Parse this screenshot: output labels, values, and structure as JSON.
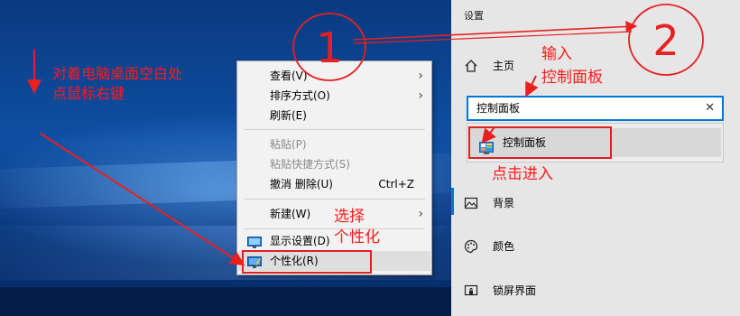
{
  "context_menu": {
    "items": [
      {
        "label": "查看(V)",
        "disabled": false,
        "arrow": true
      },
      {
        "label": "排序方式(O)",
        "disabled": false,
        "arrow": true
      },
      {
        "label": "刷新(E)",
        "disabled": false,
        "arrow": false
      },
      {
        "label": "粘贴(P)",
        "disabled": true,
        "arrow": false
      },
      {
        "label": "粘贴快捷方式(S)",
        "disabled": true,
        "arrow": false
      },
      {
        "label": "撤消 删除(U)",
        "shortcut": "Ctrl+Z",
        "disabled": false,
        "arrow": false
      },
      {
        "label": "新建(W)",
        "disabled": false,
        "arrow": true
      },
      {
        "label": "显示设置(D)",
        "disabled": false,
        "arrow": false,
        "icon": "display-icon"
      },
      {
        "label": "个性化(R)",
        "disabled": false,
        "arrow": false,
        "icon": "personalize-icon"
      }
    ]
  },
  "settings": {
    "title": "设置",
    "nav": [
      {
        "label": "主页",
        "icon": "home-icon"
      },
      {
        "label": "背景",
        "icon": "picture-icon"
      },
      {
        "label": "颜色",
        "icon": "palette-icon"
      },
      {
        "label": "锁屏界面",
        "icon": "lockscreen-icon"
      }
    ],
    "search": {
      "value": "控制面板",
      "clear_icon": "close-icon"
    },
    "suggestion": {
      "label": "控制面板",
      "icon": "control-panel-icon"
    },
    "accent": "#0078d7"
  },
  "annotations": {
    "step1_line1": "对着电脑桌面空白处",
    "step1_line2": "点鼠标右键",
    "select_line1": "选择",
    "select_line2": "个性化",
    "input_line1": "输入",
    "input_line2": "控制面板",
    "click_enter": "点击进入",
    "circle1": "1",
    "circle2": "2",
    "color": "#ff1a1a"
  }
}
